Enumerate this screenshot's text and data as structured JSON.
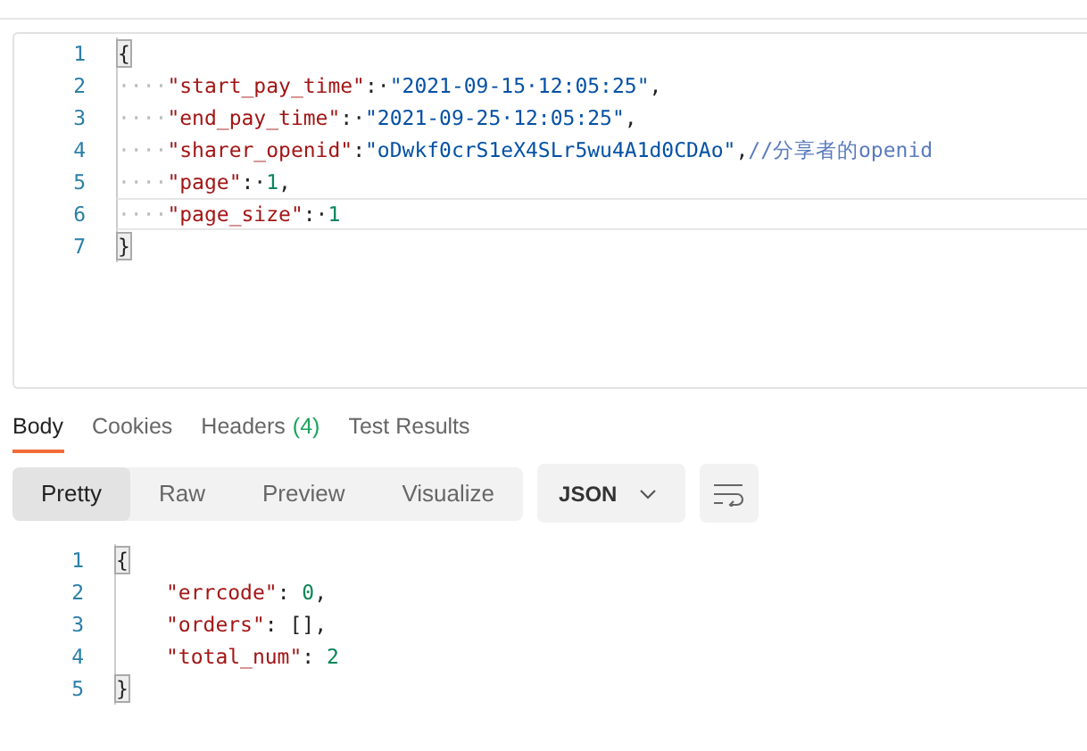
{
  "request_editor": {
    "lines": [
      {
        "number": "1",
        "active": false,
        "tokens": [
          {
            "kind": "bracket",
            "text": "{"
          }
        ]
      },
      {
        "number": "2",
        "active": false,
        "tokens": [
          {
            "kind": "ws",
            "text": "····"
          },
          {
            "kind": "key",
            "text": "\"start_pay_time\""
          },
          {
            "kind": "punct",
            "text": ":·"
          },
          {
            "kind": "string",
            "text": "\"2021-09-15·12:05:25\""
          },
          {
            "kind": "punct",
            "text": ","
          }
        ]
      },
      {
        "number": "3",
        "active": false,
        "tokens": [
          {
            "kind": "ws",
            "text": "····"
          },
          {
            "kind": "key",
            "text": "\"end_pay_time\""
          },
          {
            "kind": "punct",
            "text": ":·"
          },
          {
            "kind": "string",
            "text": "\"2021-09-25·12:05:25\""
          },
          {
            "kind": "punct",
            "text": ","
          }
        ]
      },
      {
        "number": "4",
        "active": false,
        "tokens": [
          {
            "kind": "ws",
            "text": "····"
          },
          {
            "kind": "key",
            "text": "\"sharer_openid\""
          },
          {
            "kind": "punct",
            "text": ":"
          },
          {
            "kind": "string",
            "text": "\"oDwkf0crS1eX4SLr5wu4A1d0CDAo\""
          },
          {
            "kind": "punct",
            "text": ","
          },
          {
            "kind": "comment",
            "text": "//分享者的openid"
          }
        ]
      },
      {
        "number": "5",
        "active": false,
        "tokens": [
          {
            "kind": "ws",
            "text": "····"
          },
          {
            "kind": "key",
            "text": "\"page\""
          },
          {
            "kind": "punct",
            "text": ":·"
          },
          {
            "kind": "number",
            "text": "1"
          },
          {
            "kind": "punct",
            "text": ","
          }
        ]
      },
      {
        "number": "6",
        "active": true,
        "tokens": [
          {
            "kind": "ws",
            "text": "····"
          },
          {
            "kind": "key",
            "text": "\"page_size\""
          },
          {
            "kind": "punct",
            "text": ":·"
          },
          {
            "kind": "number",
            "text": "1"
          }
        ]
      },
      {
        "number": "7",
        "active": false,
        "tokens": [
          {
            "kind": "bracket",
            "text": "}"
          }
        ]
      }
    ]
  },
  "response_tabs": [
    {
      "label": "Body",
      "selected": true
    },
    {
      "label": "Cookies",
      "selected": false
    },
    {
      "label": "Headers",
      "count": "(4)",
      "selected": false
    },
    {
      "label": "Test Results",
      "selected": false
    }
  ],
  "view_modes": [
    {
      "label": "Pretty",
      "selected": true
    },
    {
      "label": "Raw",
      "selected": false
    },
    {
      "label": "Preview",
      "selected": false
    },
    {
      "label": "Visualize",
      "selected": false
    }
  ],
  "format_dropdown": {
    "value": "JSON"
  },
  "response_body": {
    "lines": [
      {
        "number": "1",
        "indented": false,
        "tokens": [
          {
            "kind": "bracket",
            "text": "{"
          }
        ]
      },
      {
        "number": "2",
        "indented": true,
        "tokens": [
          {
            "kind": "key",
            "text": "\"errcode\""
          },
          {
            "kind": "punct",
            "text": ": "
          },
          {
            "kind": "number",
            "text": "0"
          },
          {
            "kind": "punct",
            "text": ","
          }
        ]
      },
      {
        "number": "3",
        "indented": true,
        "tokens": [
          {
            "kind": "key",
            "text": "\"orders\""
          },
          {
            "kind": "punct",
            "text": ": "
          },
          {
            "kind": "punct",
            "text": "[],"
          }
        ]
      },
      {
        "number": "4",
        "indented": true,
        "tokens": [
          {
            "kind": "key",
            "text": "\"total_num\""
          },
          {
            "kind": "punct",
            "text": ": "
          },
          {
            "kind": "number",
            "text": "2"
          }
        ]
      },
      {
        "number": "5",
        "indented": false,
        "tokens": [
          {
            "kind": "bracket",
            "text": "}"
          }
        ]
      }
    ]
  }
}
